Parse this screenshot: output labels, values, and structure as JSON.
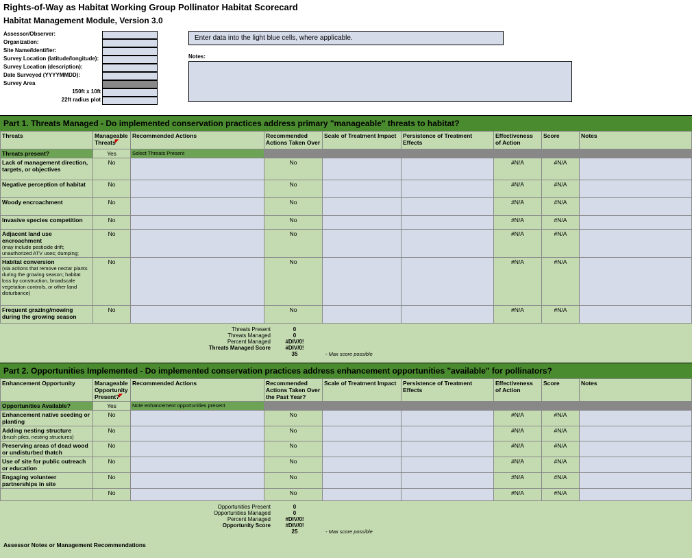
{
  "title": "Rights-of-Way as Habitat Working Group Pollinator Habitat Scorecard",
  "subtitle": "Habitat Management Module, Version 3.0",
  "meta": {
    "labels": {
      "assessor": "Assessor/Observer:",
      "org": "Organization:",
      "site": "Site Name/Identifier:",
      "latlon": "Survey Location (latitude/longitude):",
      "desc": "Survey Location (description):",
      "date": "Date Surveyed (YYYYMMDD):",
      "area": "Survey Area",
      "size1": "150ft x 10ft",
      "size2": "22ft radius plot"
    }
  },
  "instruction": "Enter data into the light blue cells, where applicable.",
  "notes_label": "Notes:",
  "part1": {
    "header": "Part 1. Threats Managed - Do implemented conservation practices address primary \"manageable\" threats to habitat?",
    "cols": {
      "threats": "Threats",
      "manageable": "Manageable Threats",
      "rec_actions": "Recommended Actions",
      "rec_taken": "Recommended Actions Taken Over",
      "scale": "Scale of Treatment Impact",
      "persist": "Persistence of Treatment Effects",
      "effect": "Effectiveness of Action",
      "score": "Score",
      "notes": "Notes"
    },
    "question": {
      "label": "Threats present?",
      "val": "Yes",
      "note": "Select Threats Present"
    },
    "rows": [
      {
        "label": "Lack of management direction, targets, or objectives",
        "sub": ""
      },
      {
        "label": "Negative perception of habitat",
        "sub": ""
      },
      {
        "label": "Woody encroachment",
        "sub": ""
      },
      {
        "label": "Invasive species competition",
        "sub": ""
      },
      {
        "label": "Adjacent land use encroachment",
        "sub": "(may include pesticide drift; unauthorized ATV uses; dumping;"
      },
      {
        "label": "Habitat conversion",
        "sub": "(via actions that remove nectar plants during the growing season; habitat loss by construction, broadscale vegetation controls, or other land disturbance)"
      },
      {
        "label": "Frequent grazing/mowing during the growing season",
        "sub": ""
      }
    ],
    "cell": {
      "no": "No",
      "na": "#N/A"
    },
    "summary": {
      "l1": "Threats Present",
      "v1": "0",
      "l2": "Threats Managed",
      "v2": "0",
      "l3": "Percent Managed",
      "v3": "#DIV/0!",
      "l4": "Threats Managed Score",
      "v4": "#DIV/0!",
      "v5": "35",
      "note": "- Max score possible"
    }
  },
  "part2": {
    "header": "Part 2. Opportunities Implemented - Do implemented conservation practices address enhancement opportunities \"available\" for pollinators?",
    "cols": {
      "opp": "Enhancement Opportunity",
      "manageable": "Manageable Opportunity Present?",
      "rec_actions": "Recommended Actions",
      "rec_taken": "Recommended Actions Taken Over the Past Year?",
      "scale": "Scale of Treatment Impact",
      "persist": "Persistence of Treatment Effects",
      "effect": "Effectiveness of Action",
      "score": "Score",
      "notes": "Notes"
    },
    "question": {
      "label": "Opportunities Available?",
      "val": "Yes",
      "note": "Note enhancement opportunities present"
    },
    "rows": [
      {
        "label": "Enhancement native seeding or planting"
      },
      {
        "label": "Adding nesting structure",
        "sub": "(brush piles, nesting structures)"
      },
      {
        "label": "Preserving areas of dead wood or undisturbed thatch"
      },
      {
        "label": "Use of site for public outreach or education"
      },
      {
        "label": "Engaging volunteer partnerships in site"
      },
      {
        "label": ""
      }
    ],
    "cell": {
      "no": "No",
      "na": "#N/A"
    },
    "summary": {
      "l1": "Opportunities Present",
      "v1": "0",
      "l2": "Opportunities Managed",
      "v2": "0",
      "l3": "Percent Managed",
      "v3": "#DIV/0!",
      "l4": "Opportunity Score",
      "v4": "#DIV/0!",
      "v5": "25",
      "note": "- Max score possible"
    },
    "recs_label": "Assessor Notes or Management Recommendations"
  }
}
